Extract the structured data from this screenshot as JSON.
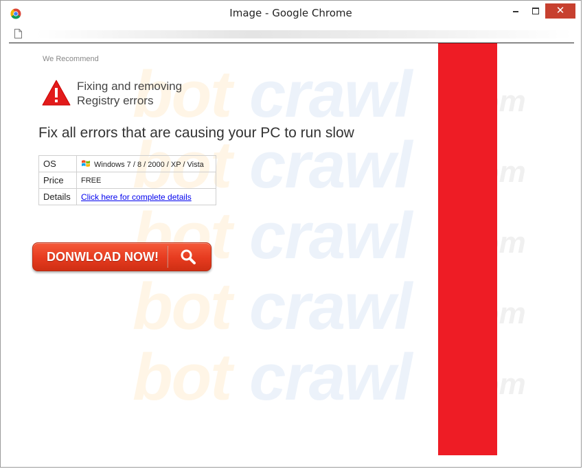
{
  "window": {
    "title": "Image - Google Chrome",
    "close_glyph": "✕"
  },
  "page": {
    "recommend": "We Recommend",
    "headline_line1": "Fixing and removing",
    "headline_line2": "Registry errors",
    "subheadline": "Fix all errors that are causing your PC to run slow",
    "table": {
      "os_label": "OS",
      "os_value": "Windows 7 / 8 / 2000 / XP / Vista",
      "price_label": "Price",
      "price_value": "FREE",
      "details_label": "Details",
      "details_link": "Click here for complete details"
    },
    "download_button": "DONWLOAD NOW!"
  },
  "watermark": {
    "part1": "bot",
    "part2": "crawl",
    "part3": ".com"
  },
  "colors": {
    "red_bar": "#ee1c25",
    "button": "#e63b1f",
    "link": "#0000ee"
  }
}
